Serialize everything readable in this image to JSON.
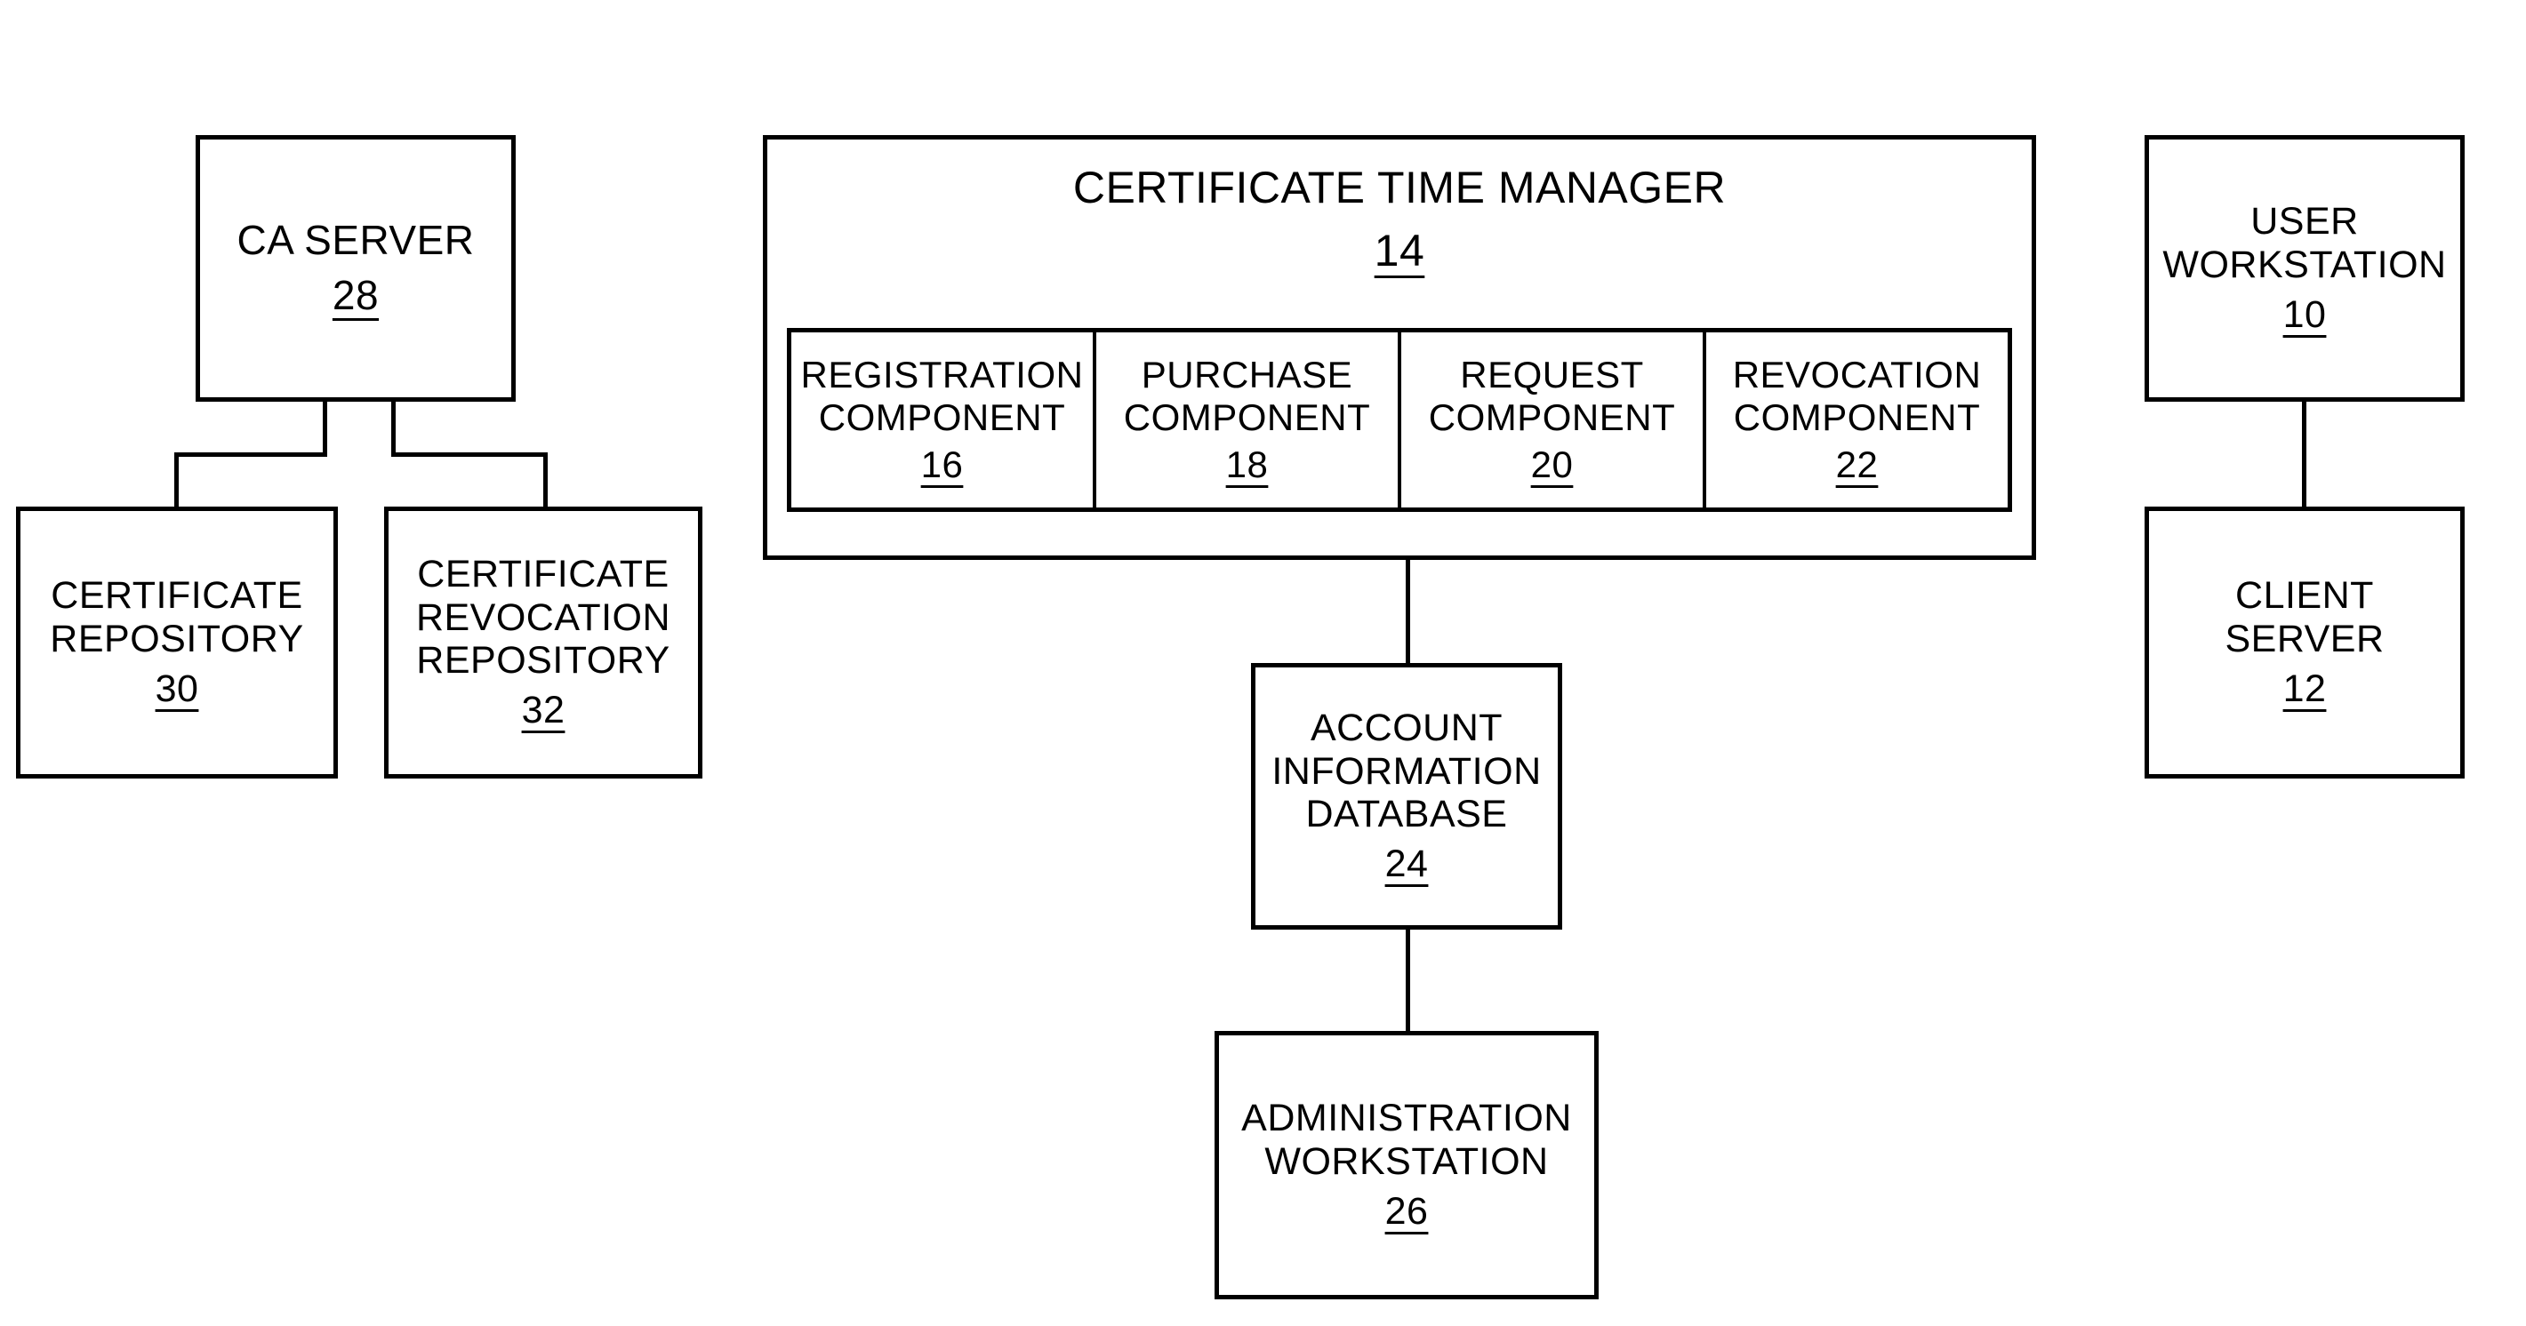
{
  "figure": {
    "kind": "patent-block-diagram",
    "background_color": "#ffffff",
    "line_color": "#000000"
  },
  "nodes": {
    "ca_server": {
      "title": "CA SERVER",
      "ref": "28"
    },
    "certificate_repository": {
      "title": "CERTIFICATE\nREPOSITORY",
      "ref": "30"
    },
    "certificate_revocation_repository": {
      "title": "CERTIFICATE\nREVOCATION\nREPOSITORY",
      "ref": "32"
    },
    "certificate_time_manager": {
      "title": "CERTIFICATE TIME MANAGER",
      "ref": "14"
    },
    "account_information_database": {
      "title": "ACCOUNT\nINFORMATION\nDATABASE",
      "ref": "24"
    },
    "administration_workstation": {
      "title": "ADMINISTRATION\nWORKSTATION",
      "ref": "26"
    },
    "user_workstation": {
      "title": "USER\nWORKSTATION",
      "ref": "10"
    },
    "client_server": {
      "title": "CLIENT\nSERVER",
      "ref": "12"
    }
  },
  "components": [
    {
      "title": "REGISTRATION\nCOMPONENT",
      "ref": "16"
    },
    {
      "title": "PURCHASE\nCOMPONENT",
      "ref": "18"
    },
    {
      "title": "REQUEST\nCOMPONENT",
      "ref": "20"
    },
    {
      "title": "REVOCATION\nCOMPONENT",
      "ref": "22"
    }
  ]
}
